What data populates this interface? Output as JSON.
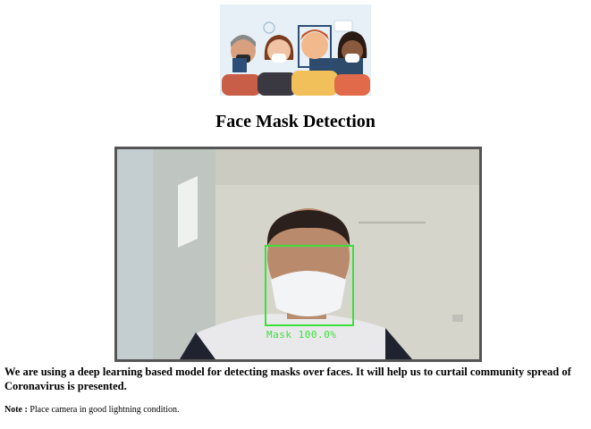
{
  "page": {
    "title": "Face Mask Detection",
    "description": "We are using a deep learning based model for detecting masks over faces. It will help us to curtail community spread of Coronavirus is presented.",
    "note_label": "Note :",
    "note_text": "Place camera in good lightning condition."
  },
  "video": {
    "detection_label": "Mask 100.0%"
  },
  "colors": {
    "detection_box": "#3de03a",
    "frame_border": "#555555"
  }
}
